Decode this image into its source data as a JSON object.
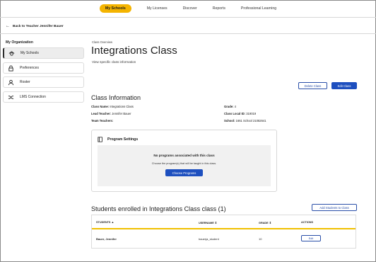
{
  "topnav": {
    "items": [
      "My Schools",
      "My Licenses",
      "Discover",
      "Reports",
      "Professional Learning"
    ],
    "active_index": 0
  },
  "back_link": "Back to Teacher Jennifer Bauer",
  "sidebar": {
    "title": "My Organization",
    "items": [
      {
        "label": "My Schools",
        "icon": "school-icon",
        "active": true
      },
      {
        "label": "Preferences",
        "icon": "lock-icon",
        "active": false
      },
      {
        "label": "Roster",
        "icon": "person-icon",
        "active": false
      },
      {
        "label": "LMS Connection",
        "icon": "shuffle-icon",
        "active": false
      }
    ]
  },
  "header": {
    "breadcrumb": "Class Overview",
    "title": "Integrations Class",
    "subtitle": "View specific class information",
    "delete_label": "Delete Class",
    "edit_label": "Edit Class"
  },
  "class_info": {
    "title": "Class Information",
    "class_name_label": "Class Name:",
    "class_name_value": "Integrations Class",
    "lead_teacher_label": "Lead Teacher:",
    "lead_teacher_value": "Jennifer Bauer",
    "team_teachers_label": "Team Teachers:",
    "grade_label": "Grade:",
    "grade_value": "4",
    "class_local_id_label": "Class Local ID:",
    "class_local_id_value": "319019",
    "school_label": "School:",
    "school_value": "1661 School 21082641"
  },
  "program_settings": {
    "title": "Program Settings",
    "empty_title": "No programs associated with this class",
    "empty_text": "Choose the program(s) that will be taught in this class.",
    "choose_label": "Choose Programs"
  },
  "students": {
    "title": "Students enrolled in Integrations Class class (1)",
    "add_label": "Add Students to Class",
    "columns": [
      "STUDENTS",
      "USERNAME",
      "GRADE",
      "ACTIONS"
    ],
    "sort_marks": [
      "▲",
      "⇕",
      "⇕"
    ],
    "rows": [
      {
        "name": "Bauer, Jennifer",
        "username": "bauerja_student",
        "grade": "10",
        "action": "Edit"
      }
    ]
  },
  "colors": {
    "accent": "#f4b400",
    "primary": "#1d4fbf"
  }
}
